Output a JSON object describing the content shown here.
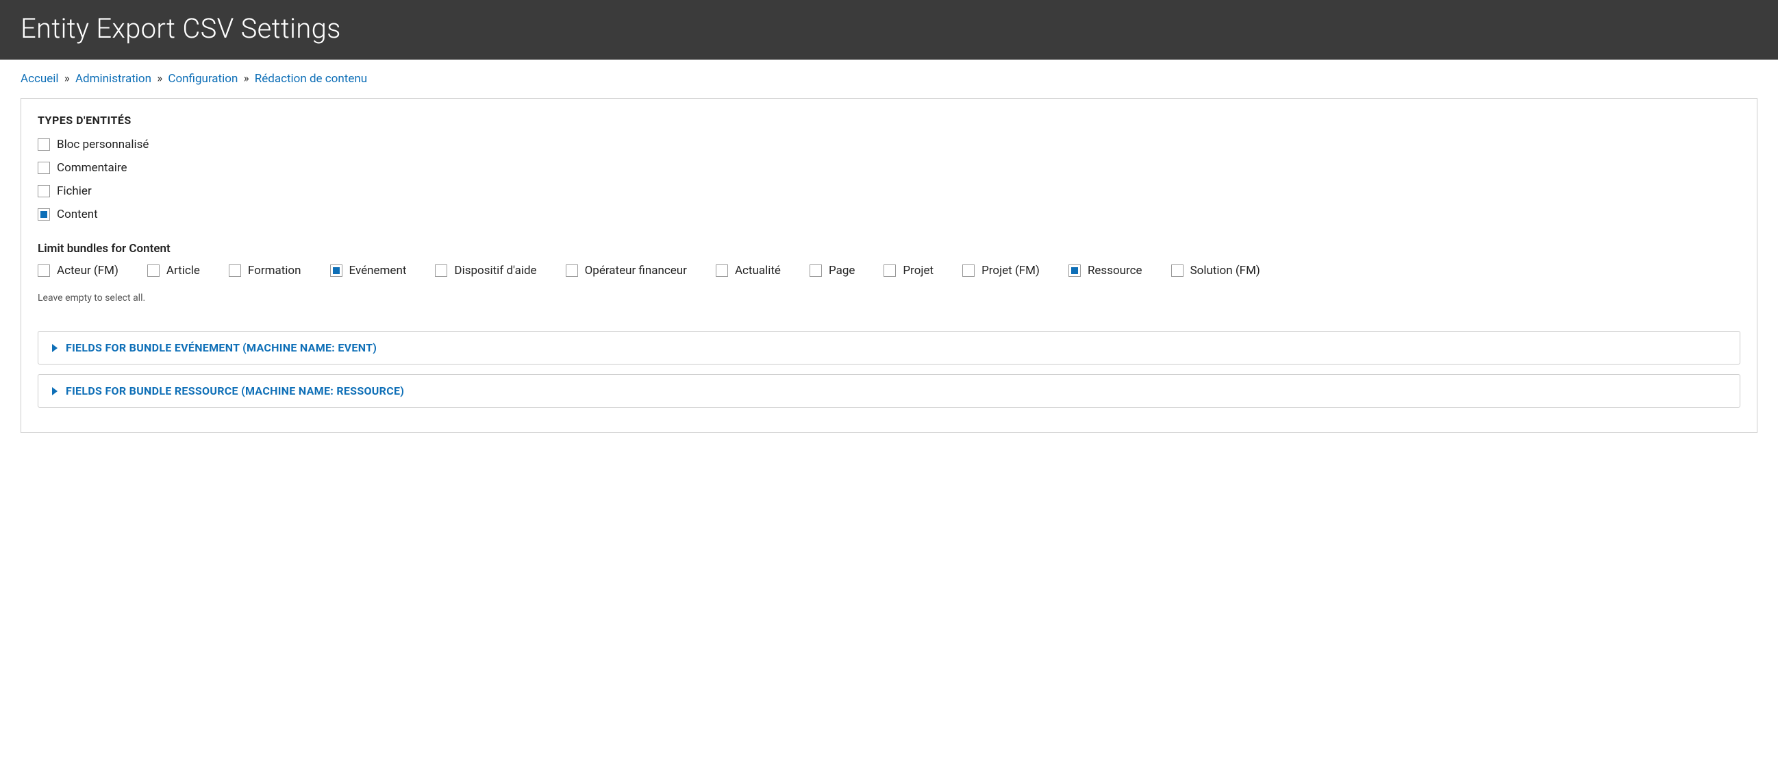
{
  "header": {
    "title": "Entity Export CSV Settings"
  },
  "breadcrumb": {
    "items": [
      {
        "label": "Accueil"
      },
      {
        "label": "Administration"
      },
      {
        "label": "Configuration"
      },
      {
        "label": "Rédaction de contenu"
      }
    ],
    "separator": "»"
  },
  "entity_types": {
    "heading": "TYPES D'ENTITÉS",
    "items": [
      {
        "label": "Bloc personnalisé",
        "checked": false
      },
      {
        "label": "Commentaire",
        "checked": false
      },
      {
        "label": "Fichier",
        "checked": false
      },
      {
        "label": "Content",
        "checked": true
      }
    ]
  },
  "bundles": {
    "heading": "Limit bundles for Content",
    "items": [
      {
        "label": "Acteur (FM)",
        "checked": false
      },
      {
        "label": "Article",
        "checked": false
      },
      {
        "label": "Formation",
        "checked": false
      },
      {
        "label": "Evénement",
        "checked": true
      },
      {
        "label": "Dispositif d'aide",
        "checked": false
      },
      {
        "label": "Opérateur financeur",
        "checked": false
      },
      {
        "label": "Actualité",
        "checked": false
      },
      {
        "label": "Page",
        "checked": false
      },
      {
        "label": "Projet",
        "checked": false
      },
      {
        "label": "Projet (FM)",
        "checked": false
      },
      {
        "label": "Ressource",
        "checked": true
      },
      {
        "label": "Solution (FM)",
        "checked": false
      }
    ],
    "help": "Leave empty to select all."
  },
  "details": [
    {
      "title": "FIELDS FOR BUNDLE EVÉNEMENT (MACHINE NAME: EVENT)"
    },
    {
      "title": "FIELDS FOR BUNDLE RESSOURCE (MACHINE NAME: RESSOURCE)"
    }
  ]
}
